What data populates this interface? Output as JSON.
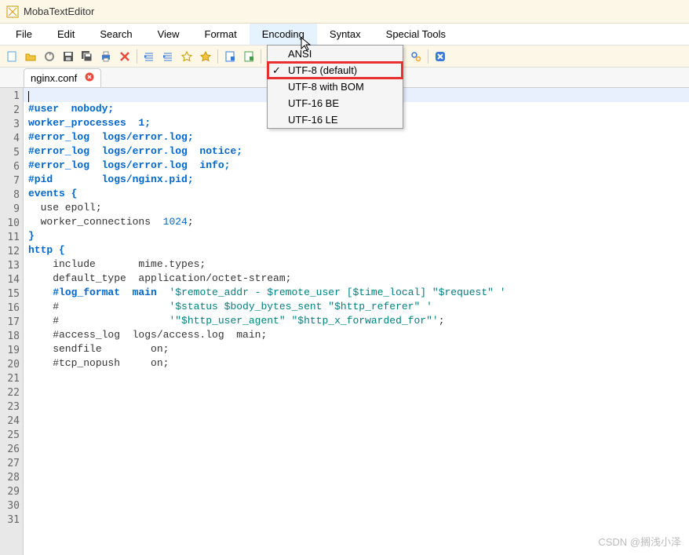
{
  "window": {
    "title": "MobaTextEditor"
  },
  "menubar": {
    "items": [
      "File",
      "Edit",
      "Search",
      "View",
      "Format",
      "Encoding",
      "Syntax",
      "Special Tools"
    ],
    "open_index": 5
  },
  "encoding_menu": {
    "items": [
      {
        "label": "ANSI",
        "checked": false
      },
      {
        "label": "UTF-8 (default)",
        "checked": true,
        "highlighted": true
      },
      {
        "label": "UTF-8 with BOM",
        "checked": false
      },
      {
        "label": "UTF-16 BE",
        "checked": false
      },
      {
        "label": "UTF-16 LE",
        "checked": false
      }
    ]
  },
  "tab": {
    "filename": "nginx.conf"
  },
  "code_lines": [
    "",
    "#user  nobody;",
    "worker_processes  1;",
    "",
    "#error_log  logs/error.log;",
    "#error_log  logs/error.log  notice;",
    "#error_log  logs/error.log  info;",
    "",
    "#pid        logs/nginx.pid;",
    "",
    "",
    "events {",
    "  use epoll;",
    "",
    "  worker_connections  1024;",
    "}",
    "",
    "",
    "http {",
    "    include       mime.types;",
    "    default_type  application/octet-stream;",
    "",
    "    #log_format  main  '$remote_addr - $remote_user [$time_local] \"$request\" '",
    "    #                  '$status $body_bytes_sent \"$http_referer\" '",
    "    #                  '\"$http_user_agent\" \"$http_x_forwarded_for\"';",
    "",
    "    #access_log  logs/access.log  main;",
    "",
    "    sendfile        on;",
    "    #tcp_nopush     on;",
    ""
  ],
  "watermark": "CSDN @搁浅小泽"
}
